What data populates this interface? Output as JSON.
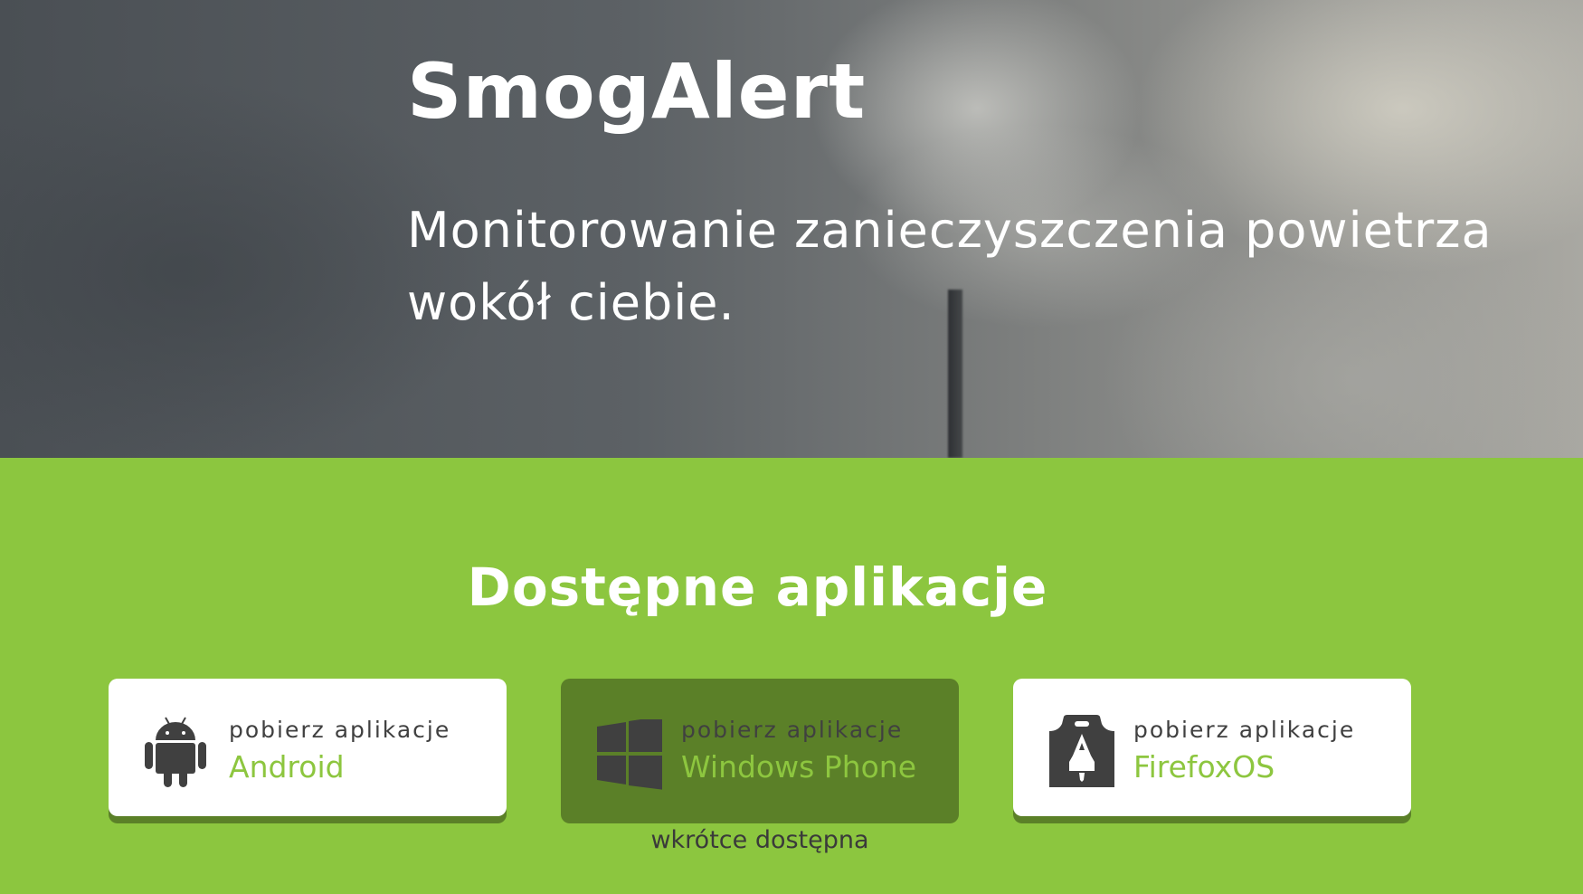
{
  "hero": {
    "title": "SmogAlert",
    "subtitle": "Monitorowanie zanieczyszczenia powietrza wokół ciebie."
  },
  "apps": {
    "heading": "Dostępne aplikacje",
    "items": [
      {
        "prefix": "pobierz aplikacje",
        "platform": "Android",
        "icon": "android-icon"
      },
      {
        "prefix": "pobierz aplikacje",
        "platform": "Windows Phone",
        "icon": "windows-icon",
        "note": "wkrótce dostępna"
      },
      {
        "prefix": "pobierz aplikacje",
        "platform": "FirefoxOS",
        "icon": "firefox-marketplace-icon"
      }
    ]
  },
  "colors": {
    "accent": "#8cc63f",
    "dark_accent": "#5b8028",
    "text_dark": "#404040"
  }
}
